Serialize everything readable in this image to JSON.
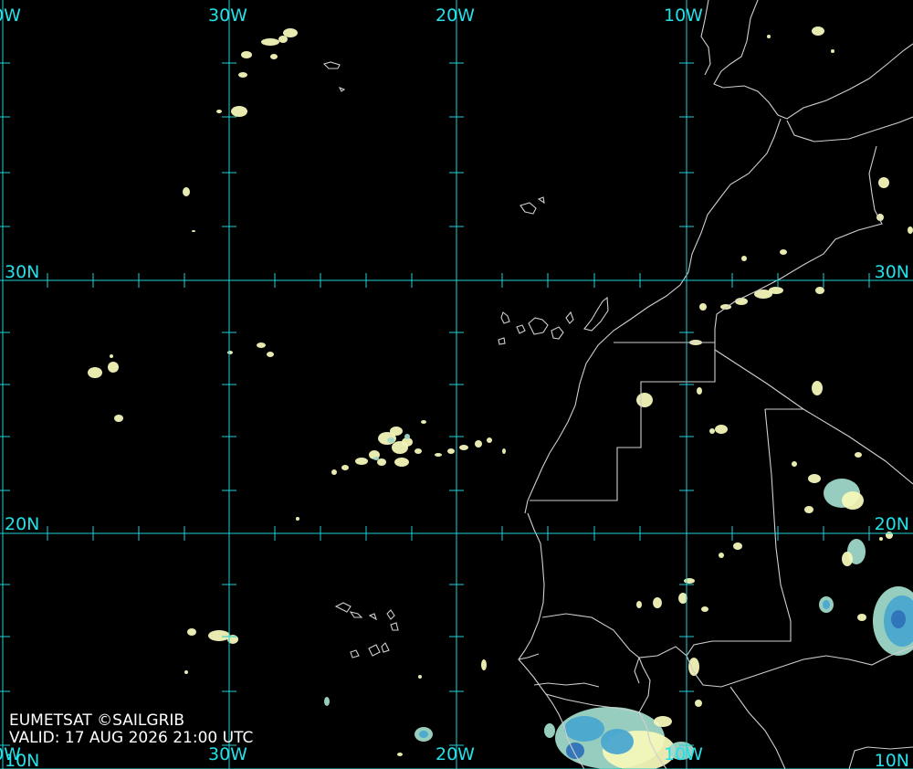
{
  "colors": {
    "background": "#000000",
    "graticule": "#1ed2d8",
    "label": "#24e0e8",
    "coastline": "#cfcfcf",
    "credit_text": "#ffffff",
    "cloud_light": "#f4f7b9",
    "cloud_mid": "#9ed8c8",
    "cloud_dense": "#4aa6d0",
    "cloud_core": "#2f73b8"
  },
  "labels": {
    "lon_top": [
      "0W",
      "30W",
      "20W",
      "10W"
    ],
    "lon_bottom": [
      "0W",
      "30W",
      "20W",
      "10W"
    ],
    "lat_left": [
      "30N",
      "20N",
      "10N"
    ],
    "lat_right": [
      "30N",
      "20N",
      "10N"
    ]
  },
  "credit": {
    "source": "EUMETSAT ©SAILGRIB",
    "valid": "VALID:  17 AUG 2026 21:00 UTC"
  },
  "legend": {
    "icons": [
      "satellite-cloud-layer",
      "coastline-layer",
      "graticule-layer"
    ]
  }
}
